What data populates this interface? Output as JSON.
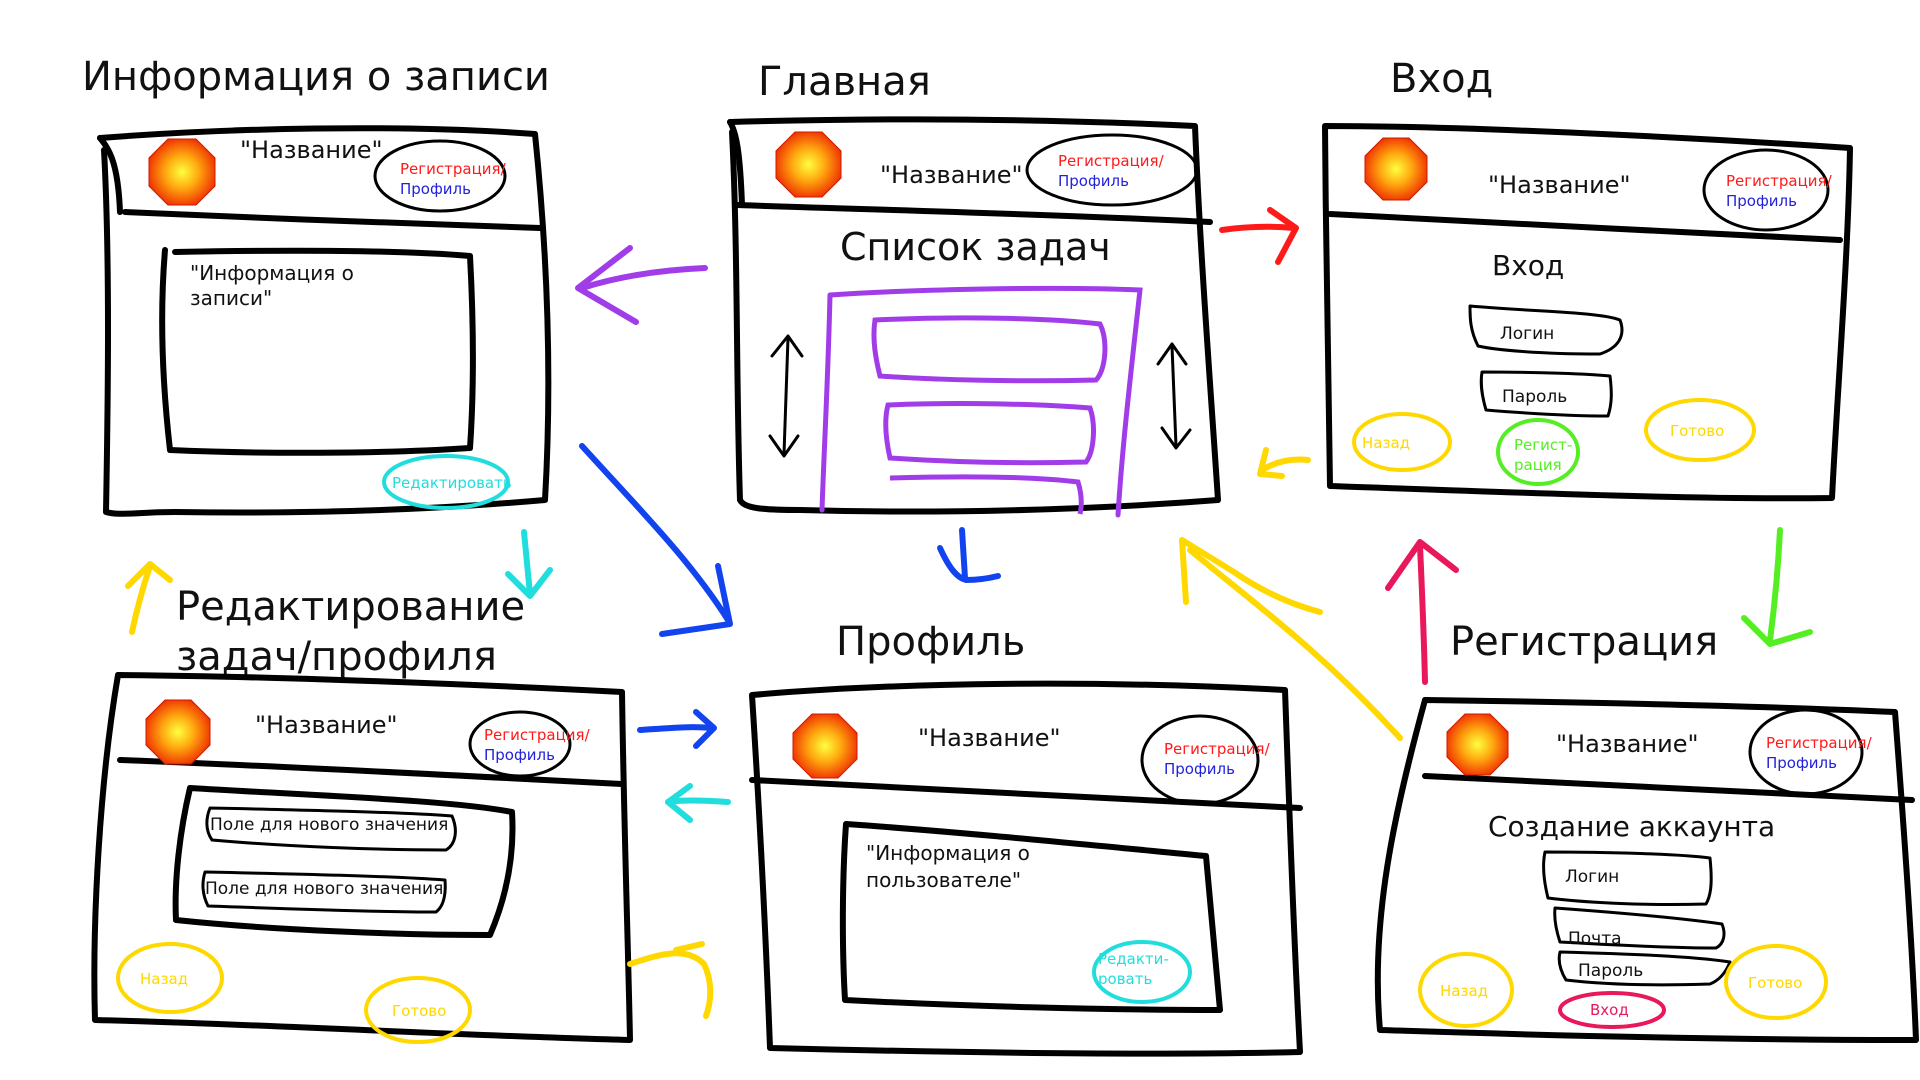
{
  "colors": {
    "ink": "#000000",
    "register": "#ff1a1a",
    "profile": "#2222dd",
    "edit_cyan": "#22dddd",
    "yellow": "#ffd800",
    "green": "#55ee22",
    "purple": "#a13de8",
    "blue_arrow": "#1144ee",
    "crimson": "#e8185a",
    "red_arrow": "#ff1a1a"
  },
  "icons": {
    "logo": "orange-octagon-logo-icon",
    "scroll": "double-headed-arrow-icon"
  },
  "common": {
    "app_name": "\"Название\"",
    "register_label": "Регистрация/",
    "profile_label": "Профиль"
  },
  "screens": {
    "record_info": {
      "title": "Информация о записи",
      "content_line1": "\"Информация о",
      "content_line2": "записи\"",
      "edit_button": "Редактировать"
    },
    "main": {
      "title": "Главная",
      "heading": "Список задач"
    },
    "login": {
      "title": "Вход",
      "heading": "Вход",
      "login_field": "Логин",
      "password_field": "Пароль",
      "back_button": "Назад",
      "register_line1": "Регист-",
      "register_line2": "рация",
      "done_button": "Готово"
    },
    "edit": {
      "title_line1": "Редактирование",
      "title_line2": "задач/профиля",
      "field1": "Поле для нового значения",
      "field2": "Поле для нового значения",
      "back_button": "Назад",
      "done_button": "Готово"
    },
    "profile": {
      "title": "Профиль",
      "content_line1": "\"Информация о",
      "content_line2": "пользователе\"",
      "edit_line1": "Редакти-",
      "edit_line2": "ровать"
    },
    "registration": {
      "title": "Регистрация",
      "heading": "Создание аккаунта",
      "login_field": "Логин",
      "email_field": "Почта",
      "password_field": "Пароль",
      "back_button": "Назад",
      "login_button": "Вход",
      "done_button": "Готово"
    }
  }
}
